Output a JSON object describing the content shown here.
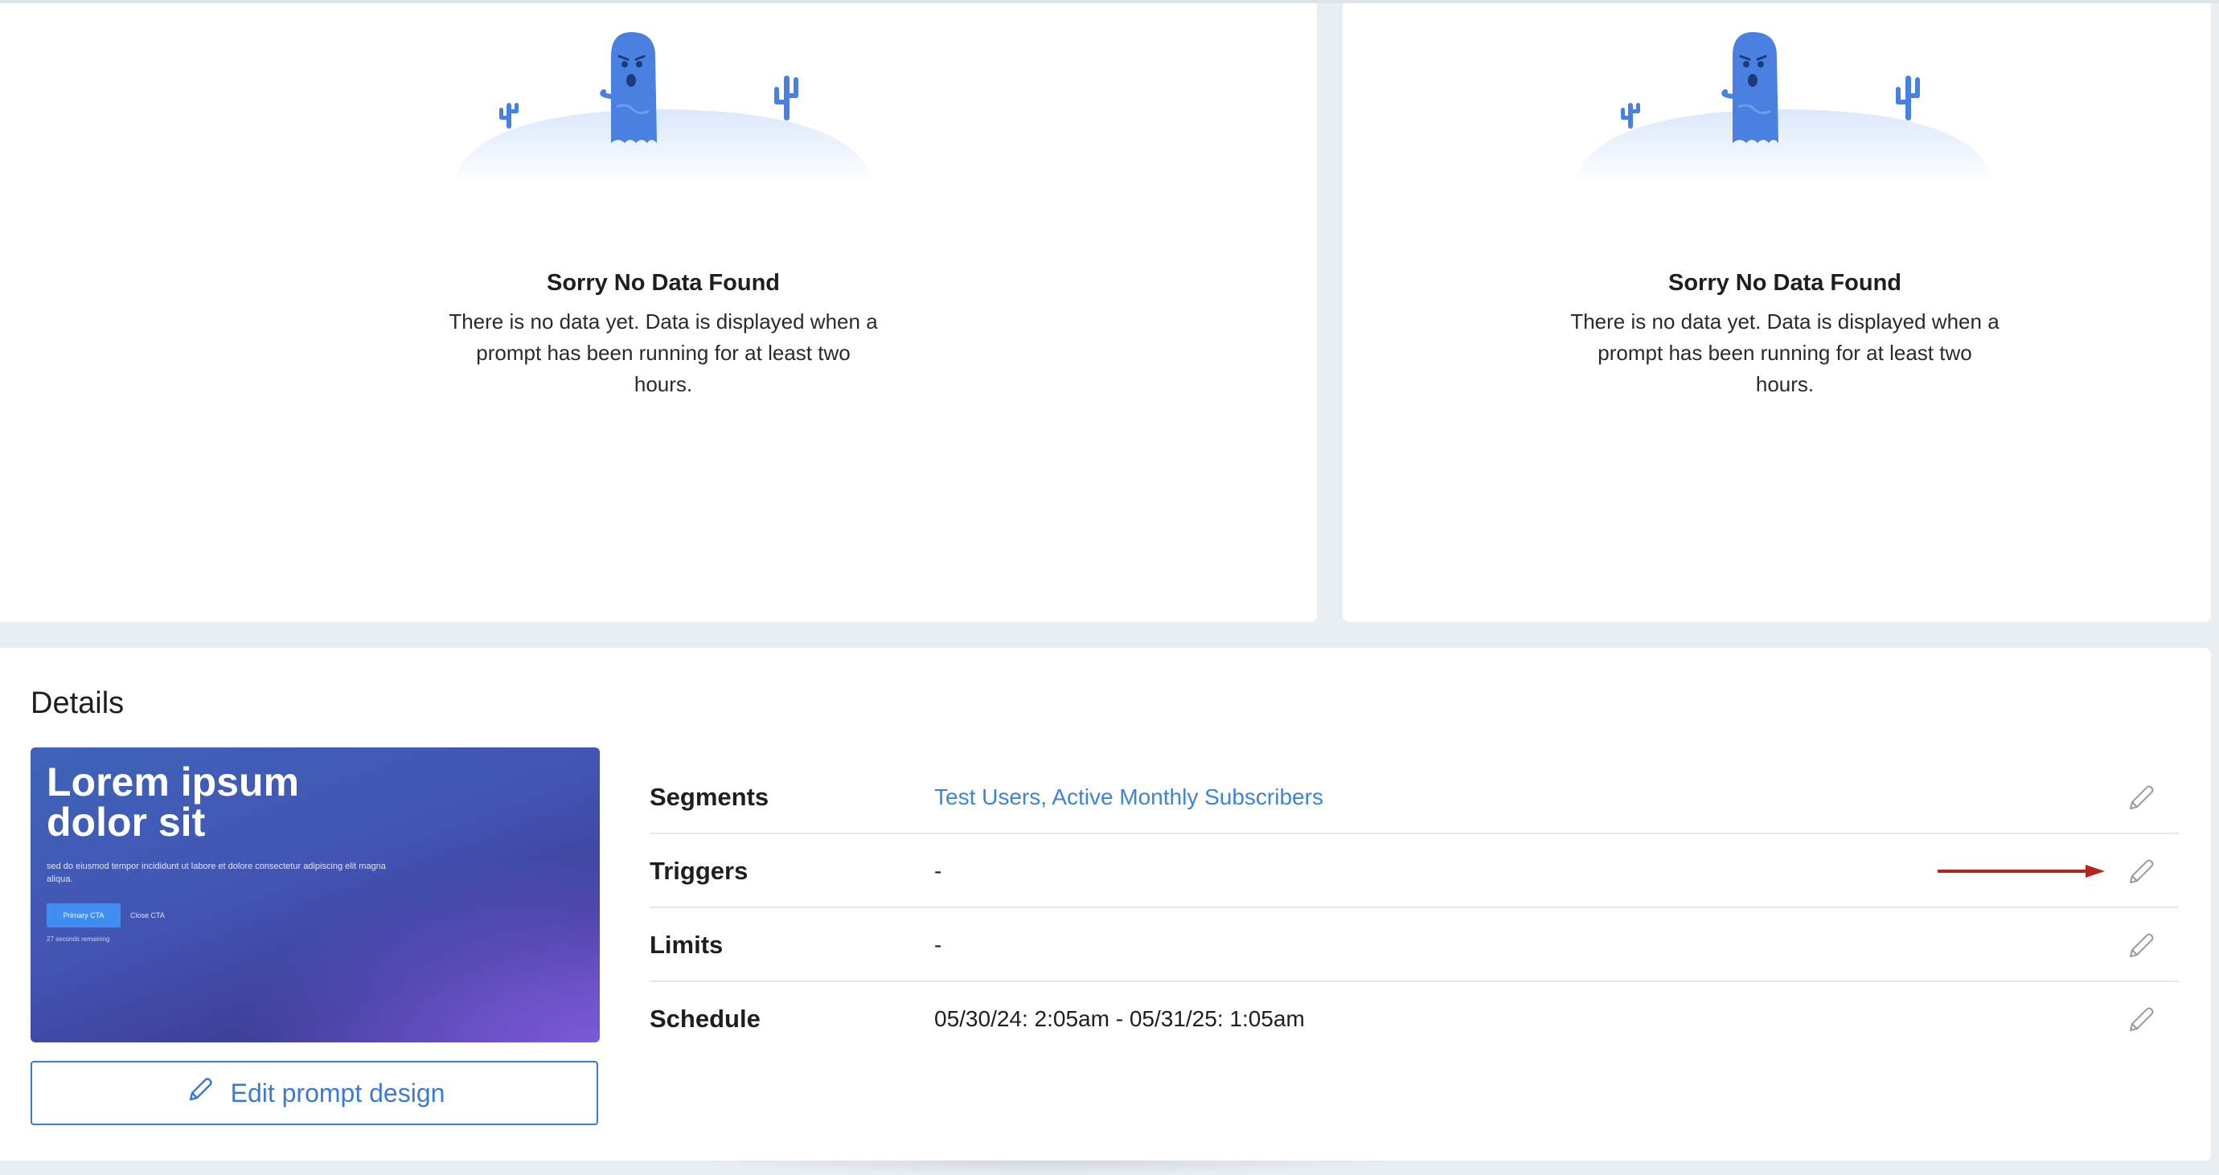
{
  "empty_states": [
    {
      "title": "Sorry No Data Found",
      "text": "There is no data yet. Data is displayed when a prompt has been running for at least two hours."
    },
    {
      "title": "Sorry No Data Found",
      "text": "There is no data yet. Data is displayed when a prompt has been running for at least two hours."
    }
  ],
  "details": {
    "title": "Details",
    "preview": {
      "title": "Lorem ipsum dolor sit",
      "body": "sed do eiusmod tempor incididunt ut labore et dolore consectetur adipiscing elit magna aliqua.",
      "primary_cta": "Primary CTA",
      "close_cta": "Close CTA",
      "timer": "27 seconds remaining"
    },
    "edit_button_label": "Edit prompt design",
    "rows": [
      {
        "label": "Segments",
        "value": "Test Users, Active Monthly Subscribers"
      },
      {
        "label": "Triggers",
        "value": "-"
      },
      {
        "label": "Limits",
        "value": "-"
      },
      {
        "label": "Schedule",
        "value": "05/30/24: 2:05am - 05/31/25: 1:05am"
      }
    ]
  },
  "colors": {
    "accent": "#3b7ad8",
    "link": "#3b84d9",
    "ghost": "#4a80e0",
    "annotation_arrow": "#b3261e",
    "page_background": "#e9eef3"
  },
  "icons": [
    "ghost-illustration",
    "cactus-icon",
    "pencil-icon",
    "arrow-annotation"
  ]
}
